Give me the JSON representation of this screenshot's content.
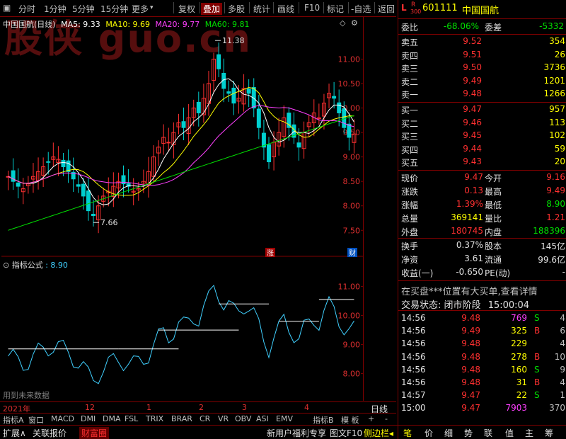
{
  "toolbar": {
    "items": [
      "分时",
      "1分钟",
      "5分钟",
      "15分钟",
      "更多"
    ],
    "buttons": [
      "复权",
      "叠加",
      "多股",
      "统计",
      "画线",
      "F10",
      "标记",
      "-自选",
      "返回"
    ],
    "more_arrow": "▾"
  },
  "chart": {
    "title": "中国国航(日线)",
    "ma5": "MA5: 9.33",
    "ma10": "MA10: 9.69",
    "ma20": "MA20: 9.77",
    "ma60": "MA60: 9.81",
    "high_mark": "11.38",
    "low_mark": "7.66",
    "price_ticks": [
      "11.00",
      "10.50",
      "10.00",
      "9.50",
      "9.00",
      "8.50",
      "8.00",
      "7.50"
    ],
    "badge_zhang": "涨",
    "badge_cai": "财",
    "watermark": "股侠  guo.cn"
  },
  "indicator": {
    "label": "指标公式",
    "value": ": 8.90",
    "ticks": [
      "11.00",
      "10.00",
      "9.00",
      "8.00"
    ],
    "note": "用到未来数据"
  },
  "xaxis": {
    "labels": [
      "2021年",
      "12",
      "1",
      "2",
      "3",
      "4"
    ],
    "period": "日线"
  },
  "chart_data": {
    "type": "line",
    "ylim": [
      7.2,
      11.6
    ],
    "closes": [
      8.6,
      8.5,
      8.4,
      8.35,
      8.45,
      8.6,
      8.7,
      8.8,
      8.9,
      9.0,
      8.95,
      8.8,
      8.7,
      8.55,
      8.4,
      8.2,
      7.9,
      7.8,
      8.0,
      8.2,
      8.3,
      8.4,
      8.5,
      8.45,
      8.4,
      8.3,
      8.35,
      8.5,
      8.7,
      9.0,
      9.2,
      9.4,
      9.3,
      9.5,
      9.7,
      9.6,
      9.8,
      10.0,
      9.9,
      10.2,
      10.5,
      11.0,
      10.8,
      10.4,
      10.3,
      10.1,
      10.2,
      10.4,
      10.3,
      10.0,
      9.6,
      9.2,
      8.9,
      9.3,
      9.5,
      9.8,
      9.6,
      9.4,
      9.2,
      9.5,
      9.7,
      9.9,
      9.8,
      10.1,
      10.3,
      10.2,
      9.9,
      9.6,
      9.4,
      9.47
    ]
  },
  "quote": {
    "tag_l": "L",
    "tag_r": "R",
    "tag_300": "300",
    "code": "601111",
    "name": "中国国航",
    "weibi_label": "委比",
    "weibi": "-68.06%",
    "weicha_label": "委差",
    "weicha": "-5332",
    "asks": [
      {
        "label": "卖五",
        "price": "9.52",
        "vol": "354"
      },
      {
        "label": "卖四",
        "price": "9.51",
        "vol": "26"
      },
      {
        "label": "卖三",
        "price": "9.50",
        "vol": "3736"
      },
      {
        "label": "卖二",
        "price": "9.49",
        "vol": "1201"
      },
      {
        "label": "卖一",
        "price": "9.48",
        "vol": "1266"
      }
    ],
    "bids": [
      {
        "label": "买一",
        "price": "9.47",
        "vol": "957"
      },
      {
        "label": "买二",
        "price": "9.46",
        "vol": "113"
      },
      {
        "label": "买三",
        "price": "9.45",
        "vol": "102"
      },
      {
        "label": "买四",
        "price": "9.44",
        "vol": "59"
      },
      {
        "label": "买五",
        "price": "9.43",
        "vol": "20"
      }
    ],
    "stats": [
      {
        "l1": "现价",
        "v1": "9.47",
        "l2": "今开",
        "v2": "9.16"
      },
      {
        "l1": "涨跌",
        "v1": "0.13",
        "l2": "最高",
        "v2": "9.49"
      },
      {
        "l1": "涨幅",
        "v1": "1.39%",
        "l2": "最低",
        "v2": "8.90"
      },
      {
        "l1": "总量",
        "v1": "369141",
        "l2": "量比",
        "v2": "1.21"
      },
      {
        "l1": "外盘",
        "v1": "180745",
        "l2": "内盘",
        "v2": "188396"
      }
    ],
    "stats2": [
      {
        "l1": "换手",
        "v1": "0.37%",
        "l2": "股本",
        "v2": "145亿"
      },
      {
        "l1": "净资",
        "v1": "3.61",
        "l2": "流通",
        "v2": "99.6亿"
      },
      {
        "l1": "收益(一)",
        "v1": "-0.650",
        "l2": "PE(动)",
        "v2": "-"
      }
    ],
    "notice": "在买盘***位置有大买单,查看详情",
    "trade_status_label": "交易状态:",
    "trade_status": "闭市阶段",
    "trade_time": "15:00:04"
  },
  "ticks": [
    {
      "time": "14:56",
      "price": "9.48",
      "vol": "769",
      "side": "S"
    },
    {
      "time": "14:56",
      "price": "9.49",
      "vol": "325",
      "side": "B"
    },
    {
      "time": "14:56",
      "price": "9.48",
      "vol": "229",
      "side": ""
    },
    {
      "time": "14:56",
      "price": "9.48",
      "vol": "278",
      "side": "B"
    },
    {
      "time": "14:56",
      "price": "9.48",
      "vol": "160",
      "side": "S"
    },
    {
      "time": "14:56",
      "price": "9.48",
      "vol": "31",
      "side": "B"
    },
    {
      "time": "14:57",
      "price": "9.47",
      "vol": "22",
      "side": "S"
    },
    {
      "time": "15:00",
      "price": "9.47",
      "vol": "7903",
      "side": ""
    }
  ],
  "tick_extra": [
    "4",
    "6",
    "4",
    "10",
    "9",
    "4",
    "1",
    "370"
  ],
  "bottom_tabs": [
    "指标A",
    "窗口",
    "MACD",
    "DMI",
    "DMA",
    "FSL",
    "TRIX",
    "BRAR",
    "CR",
    "VR",
    "OBV",
    "ASI",
    "EMV",
    "指标B",
    "模 板",
    "+",
    "-"
  ],
  "status_bar": [
    "扩展∧",
    "关联报价",
    "财富圈",
    "新用户福利专享",
    "图文F10",
    "侧边栏◂",
    "笔",
    "价",
    "细",
    "势",
    "联",
    "值",
    "主",
    "筹"
  ],
  "colors": {
    "up": "#ff3030",
    "down": "#00e000",
    "ma5": "#ffffff",
    "ma10": "#ffff00",
    "ma20": "#ff40ff",
    "ma60": "#00e000",
    "indicator": "#40d0ff"
  }
}
